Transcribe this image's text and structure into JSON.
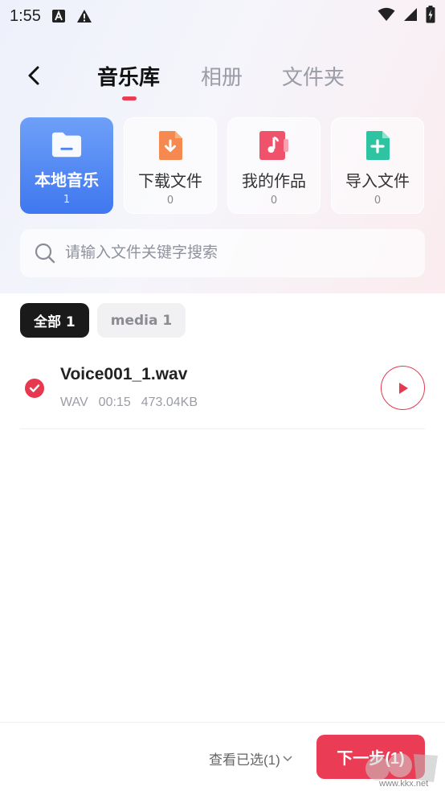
{
  "status_bar": {
    "time": "1:55",
    "icons": [
      "font-a-icon",
      "warning-icon",
      "wifi-icon",
      "signal-icon",
      "battery-charging-icon"
    ]
  },
  "nav": {
    "back_icon": "chevron-left-icon",
    "tabs": [
      {
        "label": "音乐库",
        "active": true
      },
      {
        "label": "相册",
        "active": false
      },
      {
        "label": "文件夹",
        "active": false
      }
    ]
  },
  "sources": [
    {
      "label": "本地音乐",
      "count": "1",
      "icon": "folder-icon",
      "active": true
    },
    {
      "label": "下载文件",
      "count": "0",
      "icon": "download-file-icon",
      "active": false
    },
    {
      "label": "我的作品",
      "count": "0",
      "icon": "music-note-icon",
      "active": false
    },
    {
      "label": "导入文件",
      "count": "0",
      "icon": "add-file-icon",
      "active": false
    }
  ],
  "search": {
    "placeholder": "请输入文件关键字搜索",
    "value": ""
  },
  "filters": [
    {
      "label": "全部 1",
      "active": true
    },
    {
      "label": "media 1",
      "active": false
    }
  ],
  "files": [
    {
      "name": "Voice001_1.wav",
      "format": "WAV",
      "duration": "00:15",
      "size": "473.04KB",
      "selected": true
    }
  ],
  "bottom": {
    "view_selected": "查看已选(1)",
    "next_label": "下一步(1)"
  },
  "watermark": {
    "text": "www.kkx.net"
  },
  "colors": {
    "accent": "#ea3d52",
    "active_card": "#4b82f1",
    "chip_active": "#1a1a1a"
  }
}
